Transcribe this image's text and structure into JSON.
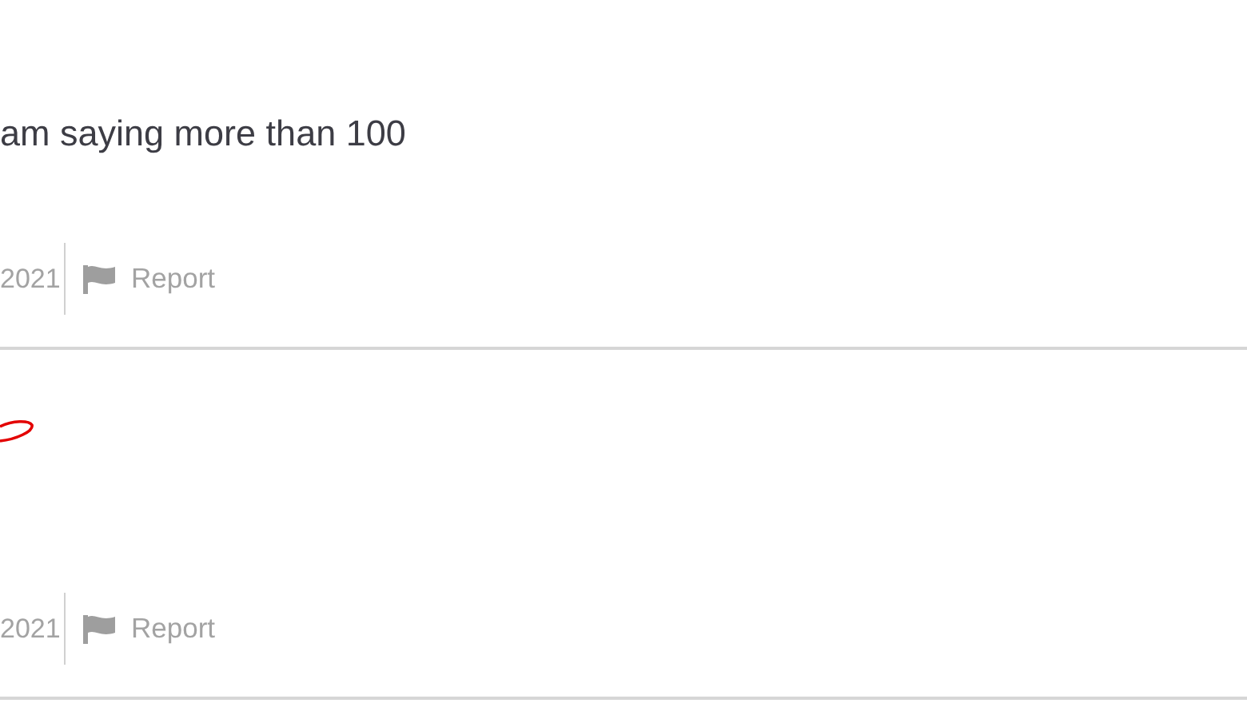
{
  "reviews": [
    {
      "kind": "text",
      "body": "am saying more than 100",
      "date": "2021",
      "report": "Report"
    },
    {
      "kind": "scribble",
      "date": "2021",
      "report": "Report"
    }
  ]
}
